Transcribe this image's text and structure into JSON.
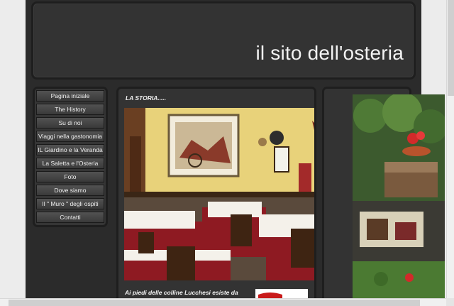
{
  "header": {
    "title": "il sito dell'osteria"
  },
  "nav": {
    "items": [
      {
        "label": "Pagina iniziale"
      },
      {
        "label": "The History"
      },
      {
        "label": "Su di noi"
      },
      {
        "label": "Viaggi nella gastonomia"
      },
      {
        "label": "IL Giardino e la Veranda"
      },
      {
        "label": "La Saletta e l'Osteria"
      },
      {
        "label": "Foto"
      },
      {
        "label": "Dove siamo"
      },
      {
        "label": "Il \" Muro \" degli ospiti"
      },
      {
        "label": "Contatti"
      }
    ]
  },
  "content": {
    "heading": "LA STORIA.....",
    "caption": "Ai piedi delle colline Lucchesi esiste da"
  },
  "colors": {
    "page_bg": "#ececec",
    "site_bg": "#2b2b2b",
    "panel_bg": "#333333",
    "text": "#f2f2f2",
    "tablecloth": "#8e1a22"
  }
}
